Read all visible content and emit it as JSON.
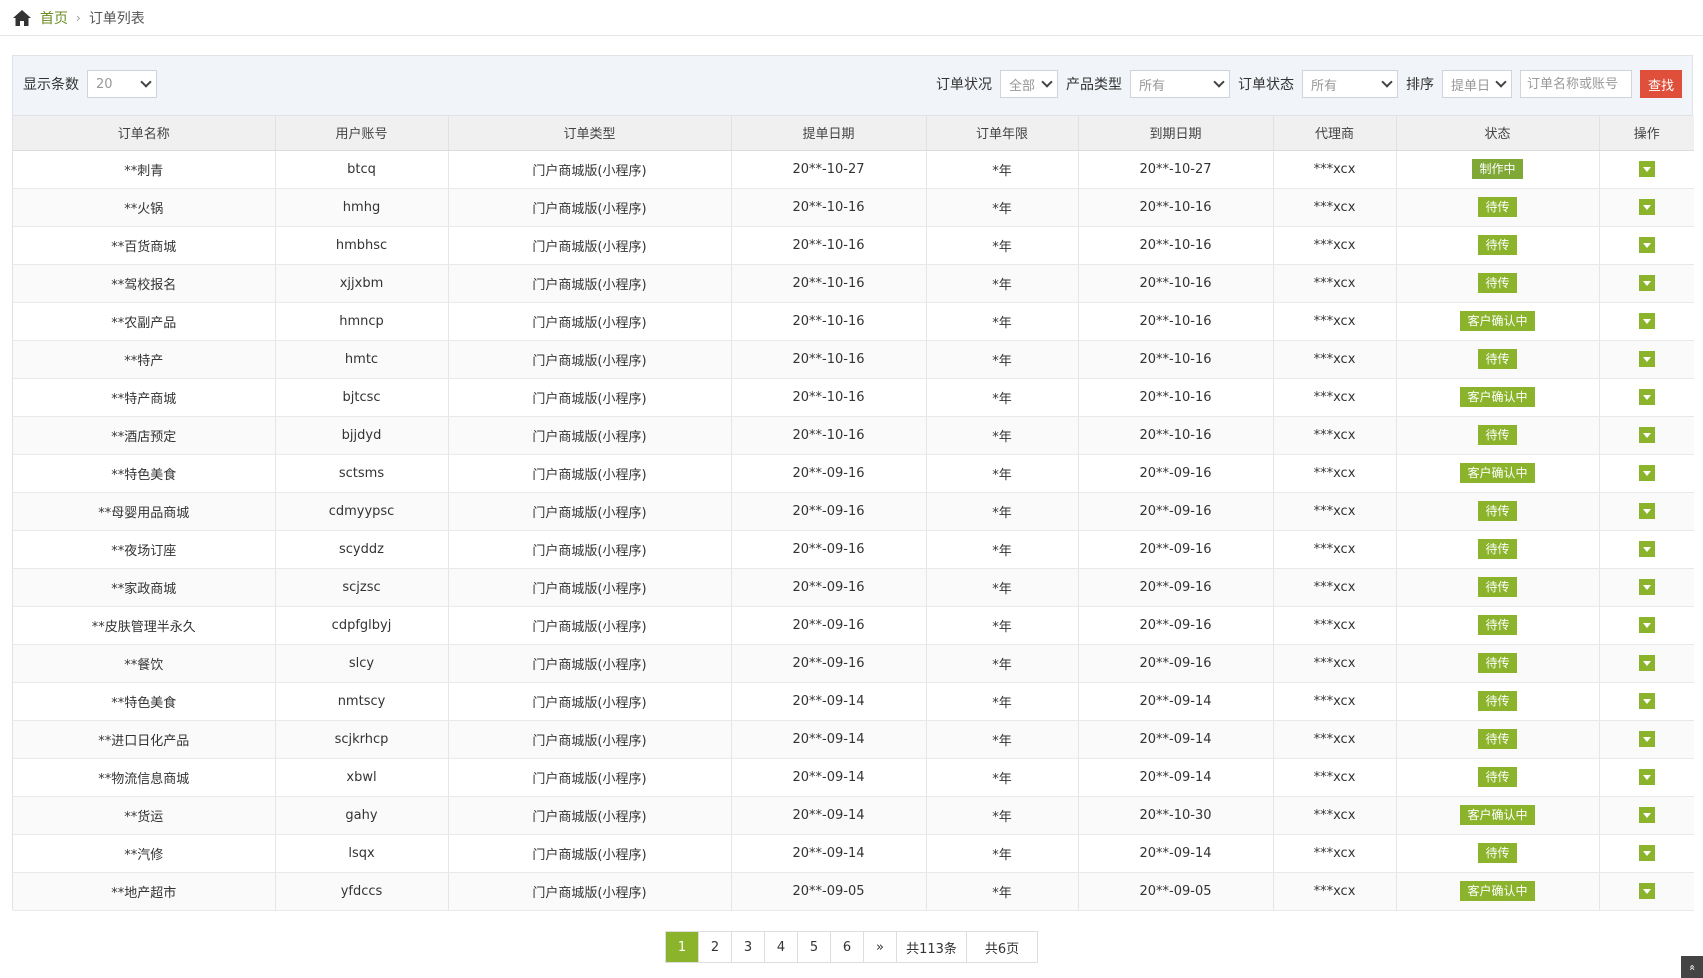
{
  "breadcrumb": {
    "home": "首页",
    "current": "订单列表"
  },
  "toolbar": {
    "page_size_label": "显示条数",
    "page_size_value": "20",
    "order_situation_label": "订单状况",
    "order_situation_value": "全部",
    "product_type_label": "产品类型",
    "product_type_value": "所有",
    "order_status_label": "订单状态",
    "order_status_value": "所有",
    "sort_label": "排序",
    "sort_value": "提单日",
    "search_placeholder": "订单名称或账号",
    "search_button": "查找"
  },
  "table": {
    "headers": [
      "订单名称",
      "用户账号",
      "订单类型",
      "提单日期",
      "订单年限",
      "到期日期",
      "代理商",
      "状态",
      "操作"
    ],
    "rows": [
      [
        "**刺青",
        "btcq",
        "门户商城版(小程序)",
        "20**-10-27",
        "*年",
        "20**-10-27",
        "***xcx",
        "制作中"
      ],
      [
        "**火锅",
        "hmhg",
        "门户商城版(小程序)",
        "20**-10-16",
        "*年",
        "20**-10-16",
        "***xcx",
        "待传"
      ],
      [
        "**百货商城",
        "hmbhsc",
        "门户商城版(小程序)",
        "20**-10-16",
        "*年",
        "20**-10-16",
        "***xcx",
        "待传"
      ],
      [
        "**驾校报名",
        "xjjxbm",
        "门户商城版(小程序)",
        "20**-10-16",
        "*年",
        "20**-10-16",
        "***xcx",
        "待传"
      ],
      [
        "**农副产品",
        "hmncp",
        "门户商城版(小程序)",
        "20**-10-16",
        "*年",
        "20**-10-16",
        "***xcx",
        "客户确认中"
      ],
      [
        "**特产",
        "hmtc",
        "门户商城版(小程序)",
        "20**-10-16",
        "*年",
        "20**-10-16",
        "***xcx",
        "待传"
      ],
      [
        "**特产商城",
        "bjtcsc",
        "门户商城版(小程序)",
        "20**-10-16",
        "*年",
        "20**-10-16",
        "***xcx",
        "客户确认中"
      ],
      [
        "**酒店预定",
        "bjjdyd",
        "门户商城版(小程序)",
        "20**-10-16",
        "*年",
        "20**-10-16",
        "***xcx",
        "待传"
      ],
      [
        "**特色美食",
        "sctsms",
        "门户商城版(小程序)",
        "20**-09-16",
        "*年",
        "20**-09-16",
        "***xcx",
        "客户确认中"
      ],
      [
        "**母婴用品商城",
        "cdmyypsc",
        "门户商城版(小程序)",
        "20**-09-16",
        "*年",
        "20**-09-16",
        "***xcx",
        "待传"
      ],
      [
        "**夜场订座",
        "scyddz",
        "门户商城版(小程序)",
        "20**-09-16",
        "*年",
        "20**-09-16",
        "***xcx",
        "待传"
      ],
      [
        "**家政商城",
        "scjzsc",
        "门户商城版(小程序)",
        "20**-09-16",
        "*年",
        "20**-09-16",
        "***xcx",
        "待传"
      ],
      [
        "**皮肤管理半永久",
        "cdpfglbyj",
        "门户商城版(小程序)",
        "20**-09-16",
        "*年",
        "20**-09-16",
        "***xcx",
        "待传"
      ],
      [
        "**餐饮",
        "slcy",
        "门户商城版(小程序)",
        "20**-09-16",
        "*年",
        "20**-09-16",
        "***xcx",
        "待传"
      ],
      [
        "**特色美食",
        "nmtscy",
        "门户商城版(小程序)",
        "20**-09-14",
        "*年",
        "20**-09-14",
        "***xcx",
        "待传"
      ],
      [
        "**进口日化产品",
        "scjkrhcp",
        "门户商城版(小程序)",
        "20**-09-14",
        "*年",
        "20**-09-14",
        "***xcx",
        "待传"
      ],
      [
        "**物流信息商城",
        "xbwl",
        "门户商城版(小程序)",
        "20**-09-14",
        "*年",
        "20**-09-14",
        "***xcx",
        "待传"
      ],
      [
        "**货运",
        "gahy",
        "门户商城版(小程序)",
        "20**-09-14",
        "*年",
        "20**-10-30",
        "***xcx",
        "客户确认中"
      ],
      [
        "**汽修",
        "lsqx",
        "门户商城版(小程序)",
        "20**-09-14",
        "*年",
        "20**-09-14",
        "***xcx",
        "待传"
      ],
      [
        "**地产超市",
        "yfdccs",
        "门户商城版(小程序)",
        "20**-09-05",
        "*年",
        "20**-09-05",
        "***xcx",
        "客户确认中"
      ]
    ]
  },
  "pager": {
    "pages": [
      "1",
      "2",
      "3",
      "4",
      "5",
      "6"
    ],
    "next": "»",
    "total_items": "共113条",
    "total_pages": "共6页"
  },
  "back_top": "«"
}
